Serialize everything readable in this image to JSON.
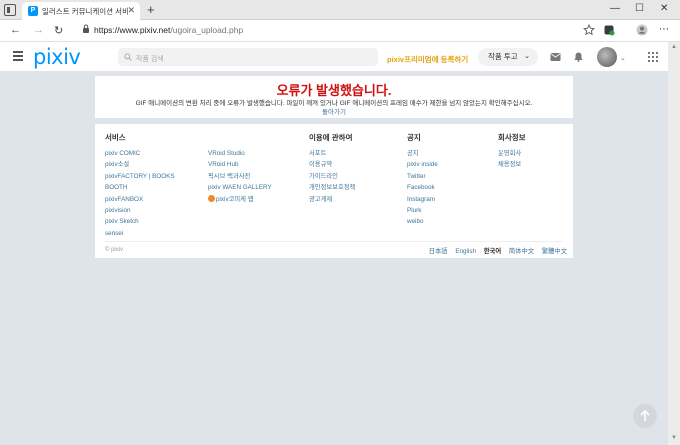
{
  "browser": {
    "tab_title": "일러스트 커뮤니케이션 서비스[p",
    "favicon_letter": "P",
    "new_tab": "+",
    "window_controls": [
      "—",
      "☐",
      "✕"
    ],
    "url_host": "https://www.pixiv.net",
    "url_path": "/ugoira_upload.php"
  },
  "header": {
    "logo": "pixiv",
    "search_placeholder": "작품 검색",
    "premium_link": "pixiv프리미엄에 등록하기",
    "submit_button": "작품 투고",
    "submit_chevron": "⌄",
    "avatar_chevron": "⌄"
  },
  "error": {
    "title": "오류가 발생했습니다.",
    "message": "GIF 애니메이션의 변환 처리 중에 오류가 발생했습니다. 파일이 깨져 있거나 GIF 애니메이션의 프레임 매수가 제한을 넘지 않았는지 확인해주십시오.",
    "back_link": "돌아가기"
  },
  "footer": {
    "columns": [
      {
        "heading": "서비스",
        "links": [
          "pixiv COMIC",
          "pixiv소설",
          "pixivFACTORY | BOOKS",
          "BOOTH",
          "pixivFANBOX",
          "pixivision",
          "pixiv Sketch",
          "sensei"
        ]
      },
      {
        "heading": "",
        "links": [
          "VRoid Studio",
          "VRoid Hub",
          "픽시브 백과사전",
          "pixiv WAEN GALLERY",
          "pixiv코미케 앱"
        ]
      },
      {
        "heading": "이용에 관하여",
        "links": [
          "서포트",
          "이용규약",
          "가이드라인",
          "개인정보보호정책",
          "광고게재"
        ]
      },
      {
        "heading": "공지",
        "links": [
          "공지",
          "pixiv inside",
          "Twitter",
          "Facebook",
          "Instagram",
          "Plurk",
          "weibo"
        ]
      },
      {
        "heading": "회사정보",
        "links": [
          "운영회사",
          "채용정보"
        ]
      }
    ],
    "copyright": "© pixiv",
    "languages": [
      "日本語",
      "English",
      "한국어",
      "简体中文",
      "繁體中文"
    ]
  },
  "colors": {
    "accent": "#0096fa",
    "error": "#d01010",
    "premium": "#e6a00e",
    "link": "#3d7699"
  }
}
